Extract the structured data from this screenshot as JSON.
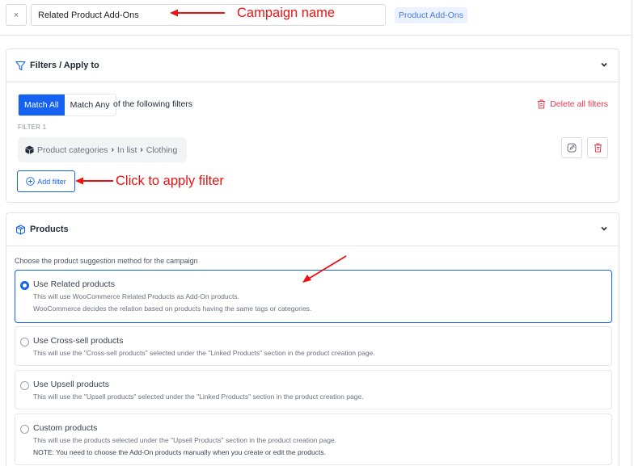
{
  "header": {
    "close_label": "×",
    "campaign_name_value": "Related Product Add-Ons",
    "campaign_type_badge": "Product Add-Ons"
  },
  "annotations": {
    "campaign_name": "Campaign name",
    "add_filter": "Click to apply filter"
  },
  "filters_panel": {
    "title": "Filters / Apply to",
    "match_all_label": "Match All",
    "match_any_label": "Match Any",
    "match_selected": "Match All",
    "match_suffix": "of the following filters",
    "delete_all_label": "Delete all filters",
    "filters": [
      {
        "label": "FILTER 1",
        "field": "Product categories",
        "operator": "In list",
        "value": "Clothing"
      }
    ],
    "add_filter_label": "Add filter"
  },
  "products_panel": {
    "title": "Products",
    "prompt": "Choose the product suggestion method for the campaign",
    "options": [
      {
        "title": "Use Related products",
        "selected": true,
        "desc": [
          "This will use WooCommerce Related Products as Add-On products.",
          "WooCommerce decides the relation based on products having the same tags or categories."
        ]
      },
      {
        "title": "Use Cross-sell products",
        "selected": false,
        "desc": [
          "This will use the \"Cross-sell products\" selected under the \"Linked Products\" section in the product creation page."
        ]
      },
      {
        "title": "Use Upsell products",
        "selected": false,
        "desc": [
          "This will use the \"Upsell products\" selected under the \"Linked Products\" section in the product creation page."
        ]
      },
      {
        "title": "Custom products",
        "selected": false,
        "desc": [
          "This will use the products selected under the \"Upsell Products\" section in the product creation page.",
          "NOTE: You need to choose the Add-On products manually when you create or edit the products."
        ]
      }
    ]
  },
  "colors": {
    "primary": "#1662f0",
    "danger": "#e5384f",
    "annotation": "#ee1111",
    "badge_bg": "#ebf2ff"
  }
}
